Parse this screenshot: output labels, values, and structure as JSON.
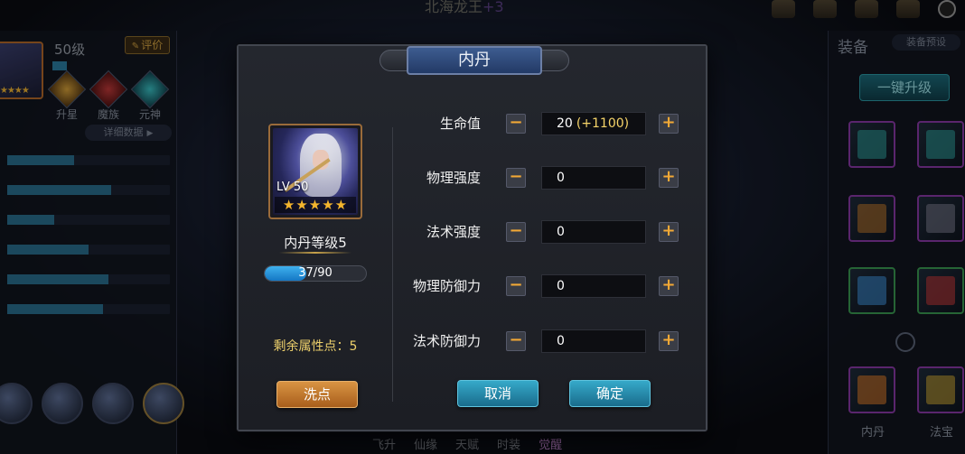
{
  "background": {
    "top_title": "北海龙王",
    "top_title_plus": "+3",
    "left_panel": {
      "level": "50级",
      "rate_button": "评价",
      "race_tags": [
        "升星",
        "魔族",
        "元神"
      ],
      "detail_button": "详细数据",
      "stat_bar_fills": [
        0.41,
        0.64,
        0.29,
        0.5,
        0.62,
        0.59
      ]
    },
    "right_panel": {
      "title": "装备",
      "preset_button": "装备预设",
      "one_key_upgrade": "一键升级",
      "bottom_slot_labels": [
        "内丹",
        "法宝"
      ]
    },
    "bottom_tabs": [
      "飞升",
      "仙缘",
      "天赋",
      "时装",
      "觉醒"
    ]
  },
  "dialog": {
    "title": "内丹",
    "hero": {
      "level_badge": "LV 50",
      "stars": "★★★★★",
      "star_count": 5
    },
    "dan_level": "内丹等级5",
    "exp": {
      "text": "37/90",
      "current": 37,
      "max": 90
    },
    "remaining_points": "剩余属性点：5",
    "reset_button": "洗点",
    "attributes": [
      {
        "label": "生命值",
        "value": "20",
        "bonus": "(+1100)"
      },
      {
        "label": "物理强度",
        "value": "0",
        "bonus": ""
      },
      {
        "label": "法术强度",
        "value": "0",
        "bonus": ""
      },
      {
        "label": "物理防御力",
        "value": "0",
        "bonus": ""
      },
      {
        "label": "法术防御力",
        "value": "0",
        "bonus": ""
      }
    ],
    "minus_glyph": "−",
    "plus_glyph": "+",
    "cancel_button": "取消",
    "confirm_button": "确定"
  },
  "colors": {
    "accent_gold": "#f3a936",
    "bonus_yellow": "#f6d469",
    "button_blue": "#36a9c9",
    "button_orange": "#d99443",
    "exp_blue": "#3fb1ee"
  }
}
